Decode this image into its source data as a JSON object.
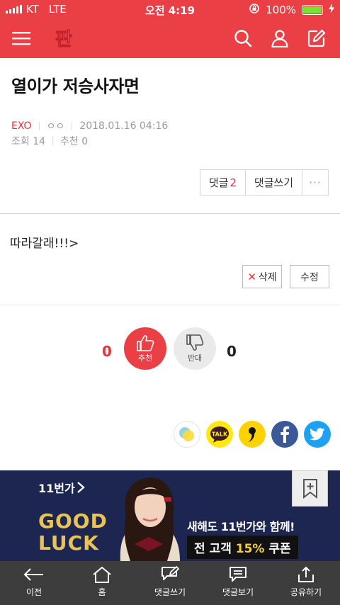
{
  "status_bar": {
    "carrier": "KT",
    "network": "LTE",
    "time": "오전 4:19",
    "battery_percent": "100%",
    "battery_level": 1.0,
    "battery_color": "#7dde3a"
  },
  "app": {
    "brand_color": "#ea3f44",
    "logo_text": "판",
    "icons": [
      "menu-icon",
      "search-icon",
      "user-icon",
      "write-icon"
    ]
  },
  "post": {
    "title": "열이가 저승사자면",
    "category": "EXO",
    "author": "ㅇㅇ",
    "datetime": "2018.01.16 04:16",
    "views_label": "조회 14",
    "recommend_label": "추천 0",
    "body": "따라갈래!!!>"
  },
  "comment_actions": {
    "comments_label": "댓글",
    "comments_count": "2",
    "write_label": "댓글쓰기",
    "more_label": "···"
  },
  "owner_actions": {
    "delete_label": "삭제",
    "edit_label": "수정"
  },
  "votes": {
    "up_count": "0",
    "up_label": "추천",
    "down_count": "0",
    "down_label": "반대"
  },
  "share_icons": [
    "kakaostory-icon",
    "kakaotalk-icon",
    "quote-icon",
    "facebook-icon",
    "twitter-icon"
  ],
  "share": {
    "talk_text": "TALK"
  },
  "banner": {
    "brand": "11번가",
    "headline_line1": "GOOD",
    "headline_line2": "LUCK",
    "copy": "새해도 11번가와 함께!",
    "coupon_prefix": "전 고객",
    "coupon_value": "15%",
    "coupon_suffix": "쿠폰"
  },
  "toolbar": {
    "items": [
      {
        "label": "이전",
        "icon": "back-arrow-icon"
      },
      {
        "label": "홈",
        "icon": "home-icon"
      },
      {
        "label": "댓글쓰기",
        "icon": "write-comment-icon"
      },
      {
        "label": "댓글보기",
        "icon": "view-comments-icon"
      },
      {
        "label": "공유하기",
        "icon": "share-icon"
      }
    ]
  }
}
